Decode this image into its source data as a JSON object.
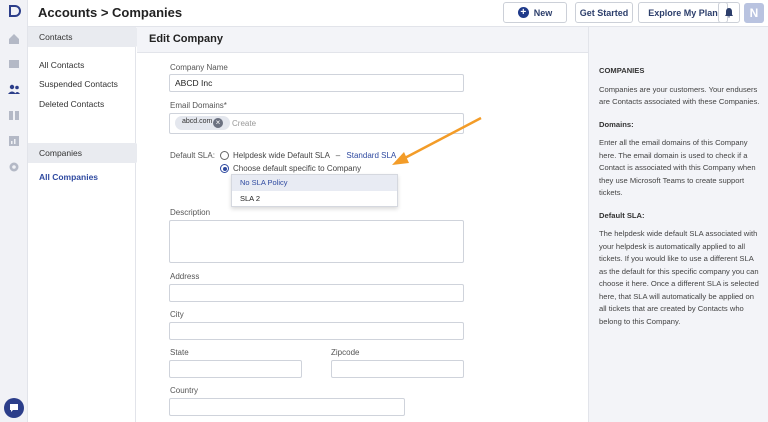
{
  "header": {
    "breadcrumb": "Accounts > Companies",
    "new_label": "New",
    "get_started_label": "Get Started",
    "explore_label": "Explore My Plan",
    "avatar_letter": "N"
  },
  "sidebar": {
    "contacts_section": "Contacts",
    "contact_items": [
      "All Contacts",
      "Suspended Contacts",
      "Deleted Contacts"
    ],
    "companies_section": "Companies",
    "company_items": [
      "All Companies"
    ]
  },
  "form": {
    "heading": "Edit Company",
    "company_name_label": "Company Name",
    "company_name_value": "ABCD Inc",
    "email_domains_label": "Email Domains*",
    "email_chip": "abcd.com",
    "email_placeholder": "Create",
    "default_sla_label": "Default SLA:",
    "radio_helpdesk": "Helpdesk wide Default SLA",
    "radio_helpdesk_sep": "–",
    "radio_helpdesk_link": "Standard SLA",
    "radio_specific": "Choose default specific to Company",
    "sla_options": [
      "No SLA Policy",
      "SLA 2"
    ],
    "description_label": "Description",
    "address_label": "Address",
    "city_label": "City",
    "state_label": "State",
    "zipcode_label": "Zipcode",
    "country_label": "Country"
  },
  "help": {
    "title": "COMPANIES",
    "intro": "Companies are your customers. Your endusers are Contacts associated with these Companies.",
    "domains_title": "Domains:",
    "domains_text": "Enter all the email domains of this Company here. The email domain is used to check if a Contact is associated with this Company when they use Microsoft Teams to create support tickets.",
    "sla_title": "Default SLA:",
    "sla_text": "The helpdesk wide default SLA associated with your helpdesk is automatically applied to all tickets. If you would like to use a different SLA as the default for this specific company you can choose it here. Once a different SLA is selected here, that SLA will automatically be applied on all tickets that are created by Contacts who belong to this Company."
  },
  "colors": {
    "accent": "#2f4aa0",
    "arrow": "#f39c28"
  }
}
